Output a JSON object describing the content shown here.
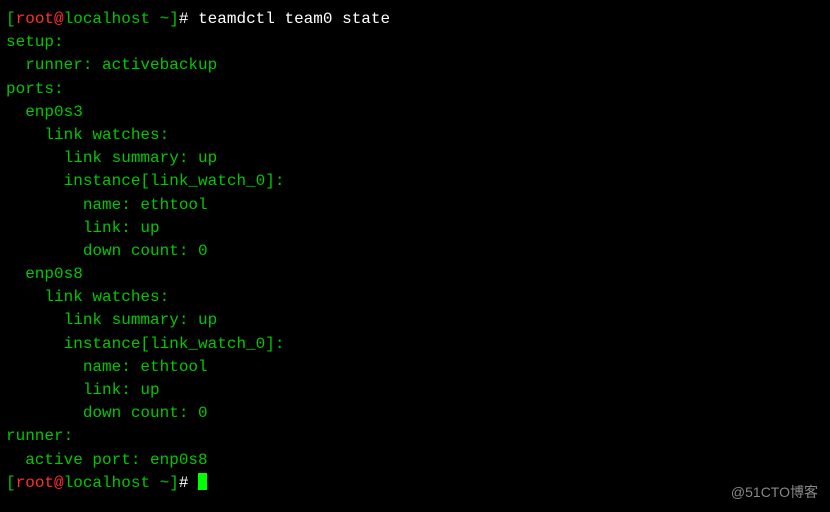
{
  "prompt": {
    "open_bracket": "[",
    "user": "root",
    "at": "@",
    "host": "localhost",
    "path": " ~",
    "close_bracket": "]",
    "hash": "# "
  },
  "command": "teamdctl team0 state",
  "output": {
    "setup": "setup:",
    "runner_line": "  runner: activebackup",
    "ports": "ports:",
    "port1_name": "  enp0s3",
    "port1_watches": "    link watches:",
    "port1_summary": "      link summary: up",
    "port1_instance": "      instance[link_watch_0]:",
    "port1_iname": "        name: ethtool",
    "port1_link": "        link: up",
    "port1_down": "        down count: 0",
    "port2_name": "  enp0s8",
    "port2_watches": "    link watches:",
    "port2_summary": "      link summary: up",
    "port2_instance": "      instance[link_watch_0]:",
    "port2_iname": "        name: ethtool",
    "port2_link": "        link: up",
    "port2_down": "        down count: 0",
    "runner": "runner:",
    "active_port": "  active port: enp0s8"
  },
  "watermark": "@51CTO博客"
}
